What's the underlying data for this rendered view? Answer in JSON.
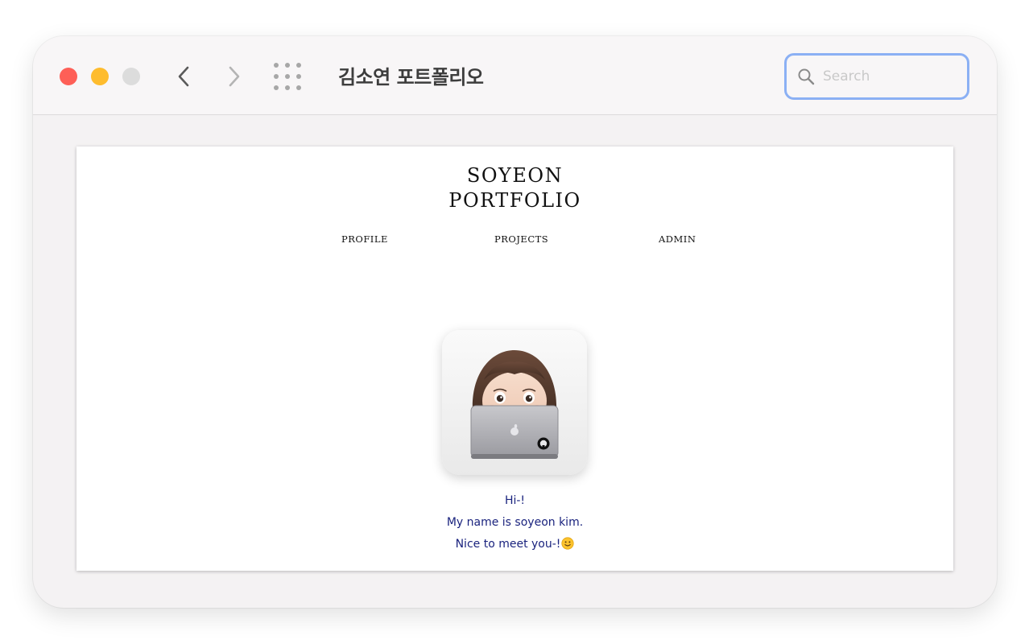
{
  "window": {
    "title": "김소연 포트폴리오",
    "search_placeholder": "Search"
  },
  "toolbar_icons": [
    "close-button",
    "minimize-button",
    "zoom-button",
    "back-chevron-icon",
    "forward-chevron-icon",
    "grid-icon",
    "search-icon"
  ],
  "site": {
    "logo_line1": "SOYEON",
    "logo_line2": "PORTFOLIO",
    "nav": [
      "PROFILE",
      "PROJECTS",
      "ADMIN"
    ],
    "avatar": "memoji-with-laptop",
    "intro": [
      "Hi-!",
      "My name is soyeon kim.",
      "Nice to meet you-!"
    ],
    "intro_emoji": "smiley-icon"
  },
  "colors": {
    "close": "#fe5f57",
    "minimize": "#febc2e",
    "zoom": "#dcdcdc",
    "search_border": "#8bb0f4",
    "intro_text": "#1a237e"
  }
}
